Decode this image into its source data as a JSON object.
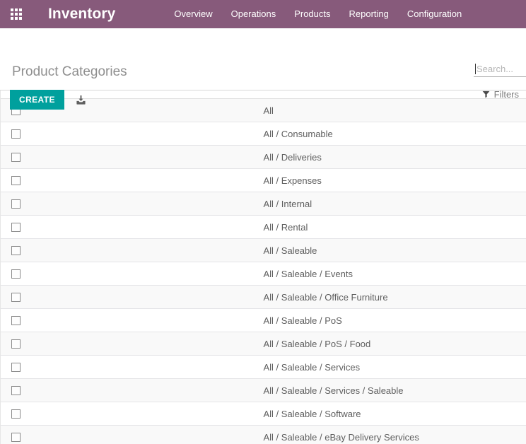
{
  "theme": {
    "navbar_color": "#875A7B",
    "primary_button_color": "#00A09D",
    "text_color": "#4C4C4C"
  },
  "navbar": {
    "apps_icon": "apps-grid-icon",
    "brand": "Inventory",
    "menu_items": [
      {
        "label": "Overview"
      },
      {
        "label": "Operations"
      },
      {
        "label": "Products"
      },
      {
        "label": "Reporting"
      },
      {
        "label": "Configuration"
      }
    ]
  },
  "control_panel": {
    "title": "Product Categories",
    "create_label": "CREATE",
    "import_icon": "download-import-icon",
    "search": {
      "value": "",
      "placeholder": "Search..."
    },
    "filters": {
      "label": "Filters",
      "icon": "funnel-icon"
    }
  },
  "list": {
    "columns": [
      ""
    ],
    "rows": [
      {
        "name": "All"
      },
      {
        "name": "All / Consumable"
      },
      {
        "name": "All / Deliveries"
      },
      {
        "name": "All / Expenses"
      },
      {
        "name": "All / Internal"
      },
      {
        "name": "All / Rental"
      },
      {
        "name": "All / Saleable"
      },
      {
        "name": "All / Saleable / Events"
      },
      {
        "name": "All / Saleable / Office Furniture"
      },
      {
        "name": "All / Saleable / PoS"
      },
      {
        "name": "All / Saleable / PoS / Food"
      },
      {
        "name": "All / Saleable / Services"
      },
      {
        "name": "All / Saleable / Services / Saleable"
      },
      {
        "name": "All / Saleable / Software"
      },
      {
        "name": "All / Saleable / eBay Delivery Services"
      }
    ]
  }
}
